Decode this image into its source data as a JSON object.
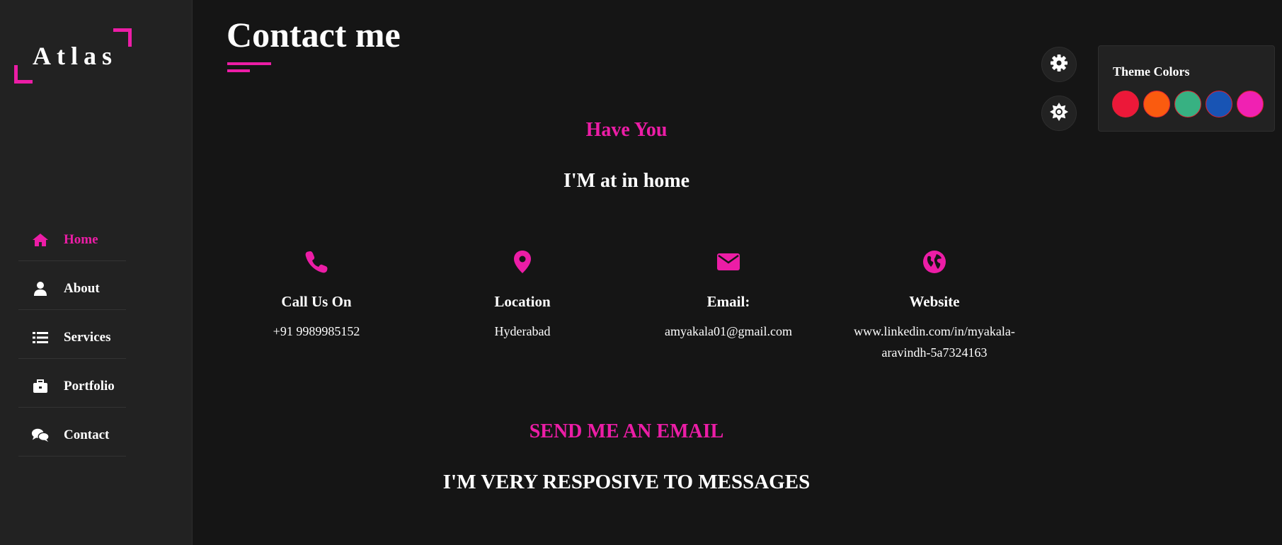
{
  "brand": {
    "name": "Atlas",
    "accent": "#ec1da6"
  },
  "sidebar": {
    "items": [
      {
        "label": "Home",
        "icon": "home-icon",
        "active": true
      },
      {
        "label": "About",
        "icon": "user-icon",
        "active": false
      },
      {
        "label": "Services",
        "icon": "list-icon",
        "active": false
      },
      {
        "label": "Portfolio",
        "icon": "briefcase-icon",
        "active": false
      },
      {
        "label": "Contact",
        "icon": "comments-icon",
        "active": false
      }
    ]
  },
  "main": {
    "title": "Contact me",
    "intro_heading": "Have You",
    "intro_sub": "I'M at in home",
    "info": [
      {
        "icon": "phone-icon",
        "title": "Call Us On",
        "value": "+91 9989985152"
      },
      {
        "icon": "location-icon",
        "title": "Location",
        "value": "Hyderabad"
      },
      {
        "icon": "envelope-icon",
        "title": "Email:",
        "value": "amyakala01@gmail.com"
      },
      {
        "icon": "globe-icon",
        "title": "Website",
        "value": "www.linkedin.com/in/myakala-aravindh-5a7324163"
      }
    ],
    "email_heading": "SEND ME AN EMAIL",
    "email_sub": "I'M VERY RESPOSIVE TO MESSAGES"
  },
  "settings": {
    "panel_title": "Theme Colors",
    "colors": [
      "#ec1839",
      "#fa5b0f",
      "#37b182",
      "#1854b4",
      "#f021b2"
    ]
  }
}
